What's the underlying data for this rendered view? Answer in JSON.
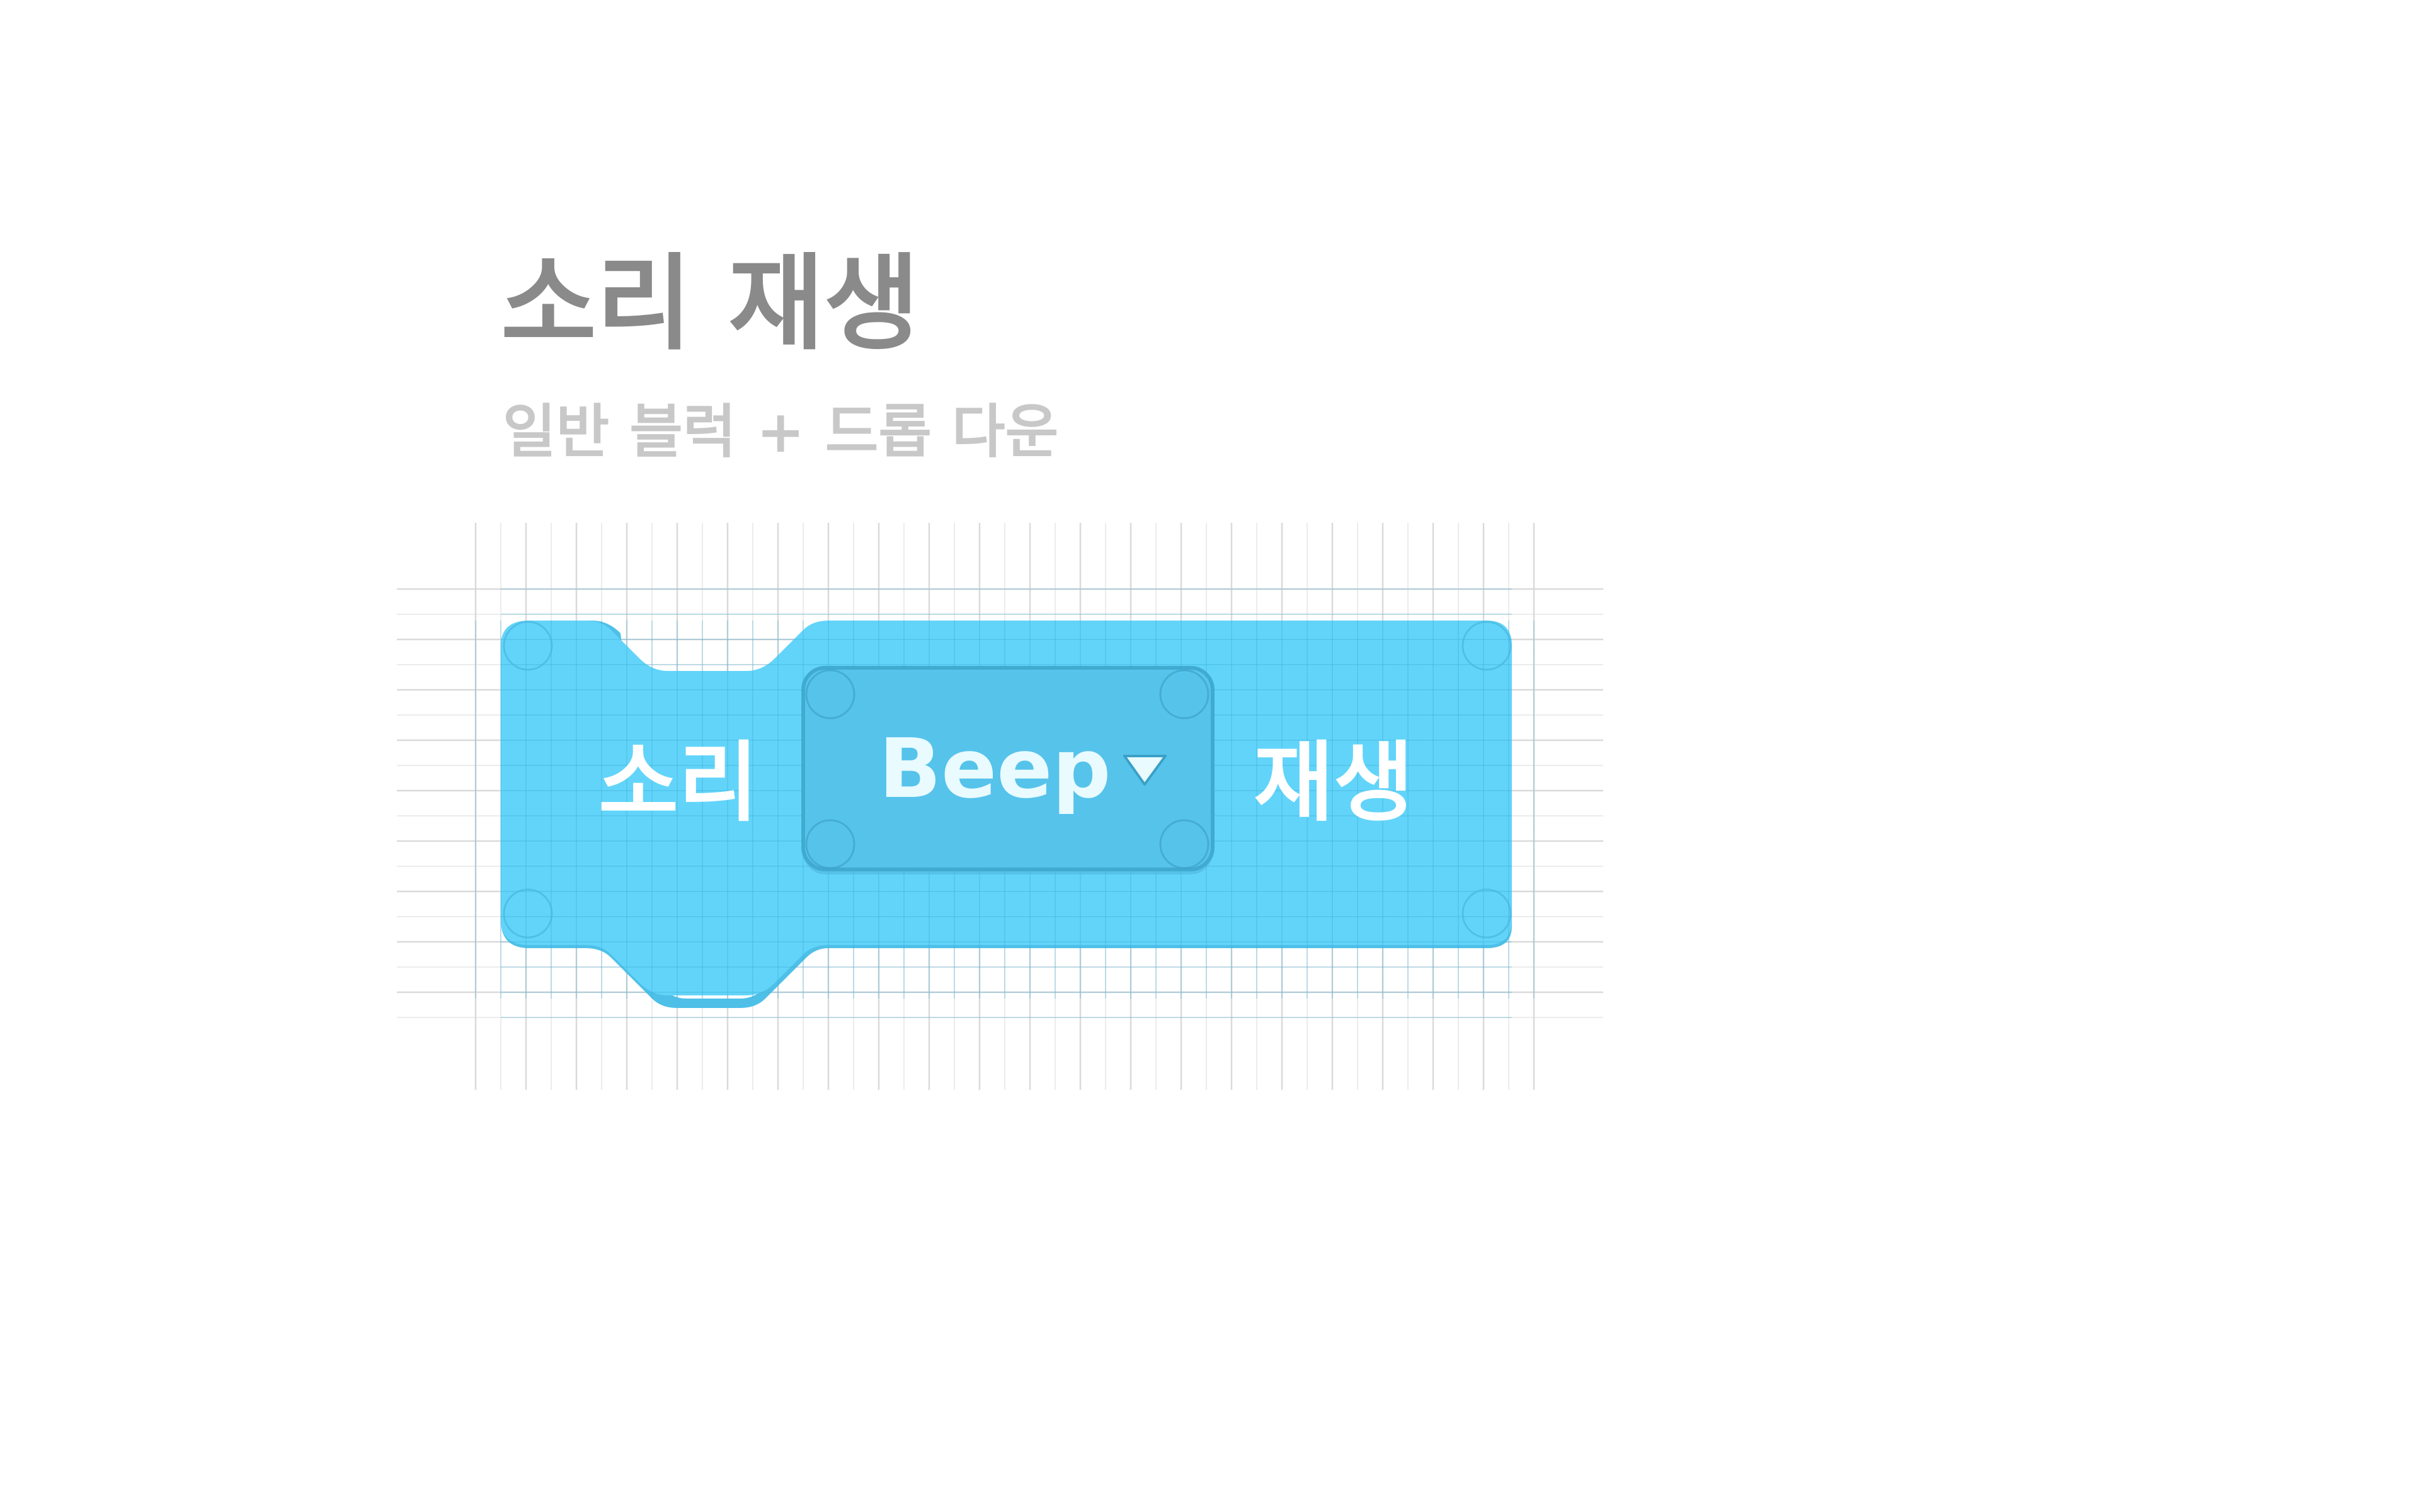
{
  "header": {
    "title": "소리 재생",
    "subtitle": "일반 블럭 + 드롭 다운"
  },
  "block": {
    "label_left": "소리",
    "dropdown_value": "Beep",
    "label_right": "재생"
  },
  "icons": {
    "dropdown_arrow": "triangle-down-icon"
  },
  "colors": {
    "block_fill": "#62d4fa",
    "block_shadow": "#4ec0e8",
    "dropdown_fill": "#56c4ec",
    "dropdown_stroke": "#3fa9cf",
    "grid_line": "#d6d6d6",
    "title": "#8a8a8a",
    "subtitle": "#c8c8c8",
    "block_text": "#ffffff"
  }
}
